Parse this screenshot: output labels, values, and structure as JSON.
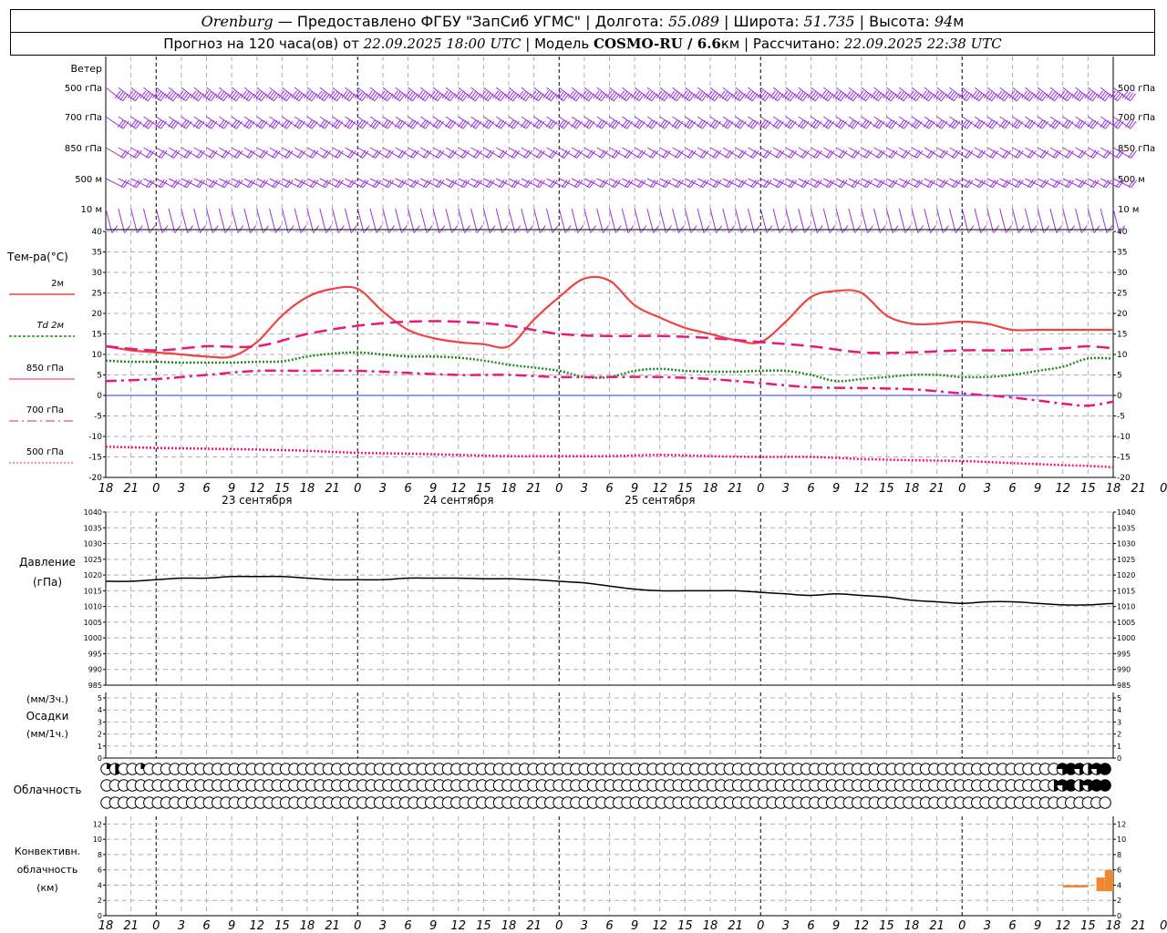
{
  "header": {
    "station": "Orenburg",
    "dash": " — ",
    "provider": "Предоставлено ФГБУ \"ЗапСиб УГМС\"",
    "sep": " | ",
    "lon_label": "Долгота: ",
    "lon_value": "55.089",
    "lat_label": "Широта: ",
    "lat_value": "51.735",
    "alt_label": "Высота: ",
    "alt_value": "94",
    "alt_unit": "м"
  },
  "subheader": {
    "forecast_label": "Прогноз на 120 часа(ов) от ",
    "forecast_time": "22.09.2025 18:00 UTC",
    "model_label": " | Модель ",
    "model_name": "COSMO-RU / 6.6",
    "model_unit": "км",
    "calc_label": " | Рассчитано: ",
    "calc_time": "22.09.2025 22:38 UTC"
  },
  "colors": {
    "wind": "#9b30d9",
    "t2m": "#ee4444",
    "td": "#1f8a1f",
    "p850": "#e8197a",
    "p700": "#e8197a",
    "p500": "#e8197a",
    "zero": "#3030ff",
    "pressure": "#000000",
    "convective": "#ee8833",
    "grid": "#b0b0b0"
  },
  "panels": {
    "wind": {
      "title": "Ветер",
      "levels": [
        "500 гПа",
        "700 гПа",
        "850 гПа",
        "500 м",
        "10  м"
      ]
    },
    "temp": {
      "title": "Тем-ра(°C)",
      "legend": [
        {
          "label": "2м",
          "key": "t2m"
        },
        {
          "label": "Td  2м",
          "key": "td"
        },
        {
          "label": "850 гПа",
          "key": "p850"
        },
        {
          "label": "700 гПа",
          "key": "p700"
        },
        {
          "label": "500 гПа",
          "key": "p500"
        }
      ],
      "ticks": [
        40,
        35,
        30,
        25,
        20,
        15,
        10,
        5,
        0,
        -5,
        -10,
        -15,
        -20
      ]
    },
    "pressure": {
      "title": "Давление",
      "unit": "(гПа)",
      "ticks": [
        1040,
        1035,
        1030,
        1025,
        1020,
        1015,
        1010,
        1005,
        1000,
        995,
        990,
        985
      ]
    },
    "precip": {
      "line1": "(мм/3ч.)",
      "line2": "Осадки",
      "line3": "(мм/1ч.)",
      "ticks": [
        5,
        4,
        3,
        2,
        1,
        0
      ]
    },
    "clouds": {
      "title": "Облачность"
    },
    "convective": {
      "line1": "Конвективн.",
      "line2": "облачность",
      "line3": "(км)",
      "ticks": [
        12,
        10,
        8,
        6,
        4,
        2,
        0
      ]
    }
  },
  "time_labels": [
    "18",
    "21",
    "0",
    "3",
    "6",
    "9",
    "12",
    "15",
    "18",
    "21",
    "0",
    "3",
    "6",
    "9",
    "12",
    "15",
    "18",
    "21",
    "0",
    "3",
    "6",
    "9",
    "12",
    "15",
    "18",
    "21",
    "0",
    "3",
    "6",
    "9",
    "12",
    "15",
    "18",
    "21",
    "0",
    "3",
    "6",
    "9",
    "12",
    "15",
    "18",
    "21",
    "0"
  ],
  "day_labels": [
    "23 сентября",
    "24 сентября",
    "25 сентября"
  ],
  "chart_data": [
    {
      "type": "line",
      "title": "Тем-ра(°C)",
      "x_unit": "hours from 22.09.2025 18:00 UTC",
      "ylim": [
        -20,
        40
      ],
      "series": [
        {
          "name": "2м",
          "x": [
            0,
            3,
            6,
            9,
            12,
            15,
            18,
            21,
            24,
            27,
            30,
            33,
            36,
            39,
            42,
            45,
            48,
            51,
            54,
            57,
            60,
            63,
            66,
            69,
            72,
            75,
            78,
            81,
            84,
            87,
            90,
            93,
            96,
            99,
            102,
            105,
            108,
            111,
            114,
            117,
            120
          ],
          "values": [
            12,
            11,
            10.5,
            10,
            9.5,
            9.5,
            13,
            19.5,
            24,
            26,
            26,
            20.5,
            16,
            14,
            13,
            12.5,
            12,
            18.5,
            24,
            28.5,
            28,
            22,
            19,
            16.5,
            15,
            13.5,
            13,
            18,
            24,
            25.5,
            25,
            19.5,
            17.5,
            17.5,
            18,
            17.5,
            16,
            16,
            16,
            16,
            16
          ]
        },
        {
          "name": "Td  2м",
          "x": [
            0,
            3,
            6,
            9,
            12,
            15,
            18,
            21,
            24,
            27,
            30,
            33,
            36,
            39,
            42,
            45,
            48,
            51,
            54,
            57,
            60,
            63,
            66,
            69,
            72,
            75,
            78,
            81,
            84,
            87,
            90,
            93,
            96,
            99,
            102,
            105,
            108,
            111,
            114,
            117,
            120
          ],
          "values": [
            8.5,
            8.2,
            8.2,
            8,
            8,
            8,
            8.2,
            8.3,
            9.5,
            10.2,
            10.5,
            10,
            9.5,
            9.5,
            9.2,
            8.5,
            7.5,
            6.8,
            6,
            4.5,
            4.5,
            6,
            6.5,
            6,
            5.8,
            5.8,
            6,
            6,
            5,
            3.5,
            4,
            4.5,
            5,
            5,
            4.5,
            4.5,
            5,
            6,
            7,
            9,
            9
          ]
        },
        {
          "name": "850 гПа",
          "x": [
            0,
            6,
            12,
            18,
            24,
            30,
            36,
            42,
            48,
            54,
            60,
            66,
            72,
            78,
            84,
            90,
            96,
            102,
            108,
            114,
            117,
            120
          ],
          "values": [
            12,
            11,
            12,
            12,
            15,
            17,
            18,
            18,
            17,
            15,
            14.5,
            14.5,
            14,
            13,
            12,
            10.5,
            10.5,
            11,
            11,
            11.5,
            12,
            11.5
          ]
        },
        {
          "name": "700 гПа",
          "x": [
            0,
            6,
            12,
            18,
            24,
            30,
            36,
            42,
            48,
            54,
            60,
            66,
            72,
            78,
            84,
            90,
            96,
            102,
            108,
            114,
            117,
            120
          ],
          "values": [
            3.5,
            4,
            5,
            6,
            6,
            6,
            5.5,
            5,
            5,
            4.5,
            4.5,
            4.5,
            4,
            3,
            2,
            1.8,
            1.5,
            0.5,
            -0.5,
            -2,
            -2.5,
            -1.5
          ]
        },
        {
          "name": "500 гПа",
          "x": [
            0,
            6,
            12,
            18,
            24,
            30,
            36,
            42,
            48,
            54,
            60,
            66,
            72,
            78,
            84,
            90,
            96,
            102,
            108,
            114,
            117,
            120
          ],
          "values": [
            -12.5,
            -12.8,
            -13,
            -13.2,
            -13.5,
            -14,
            -14.2,
            -14.5,
            -14.8,
            -14.8,
            -14.8,
            -14.5,
            -14.8,
            -15,
            -15,
            -15.5,
            -15.8,
            -16,
            -16.5,
            -17,
            -17.2,
            -17.5
          ]
        }
      ]
    },
    {
      "type": "line",
      "title": "Давление",
      "x_unit": "hours from 22.09.2025 18:00 UTC",
      "ylim": [
        985,
        1040
      ],
      "series": [
        {
          "name": "Давление",
          "x": [
            0,
            3,
            6,
            9,
            12,
            15,
            18,
            21,
            24,
            27,
            30,
            33,
            36,
            39,
            42,
            45,
            48,
            51,
            54,
            57,
            60,
            63,
            66,
            69,
            72,
            75,
            78,
            81,
            84,
            87,
            90,
            93,
            96,
            99,
            102,
            105,
            108,
            111,
            114,
            117,
            120
          ],
          "values": [
            1018,
            1018,
            1018.5,
            1019,
            1019,
            1019.5,
            1019.5,
            1019.5,
            1019,
            1018.5,
            1018.5,
            1018.5,
            1019,
            1019,
            1019,
            1018.8,
            1018.8,
            1018.5,
            1018,
            1017.5,
            1016.5,
            1015.5,
            1015,
            1015,
            1015,
            1015,
            1014.5,
            1014,
            1013.5,
            1014,
            1013.5,
            1013,
            1012,
            1011.5,
            1011,
            1011.5,
            1011.5,
            1011,
            1010.5,
            1010.5,
            1011
          ]
        }
      ]
    },
    {
      "type": "bar",
      "title": "Конвективн. облачность (км)",
      "x_unit": "hours from 22.09.2025 18:00 UTC",
      "ylim": [
        0,
        13
      ],
      "bars": [
        {
          "x_start": 114,
          "x_end": 117,
          "bottom": 3.7,
          "top": 4.0
        },
        {
          "x_start": 118,
          "x_end": 119,
          "bottom": 3.2,
          "top": 5.0
        },
        {
          "x_start": 119,
          "x_end": 120,
          "bottom": 3.2,
          "top": 6.0
        }
      ]
    },
    {
      "type": "table",
      "title": "Облачность",
      "rows": [
        {
          "cover": [
            1,
            2,
            0,
            0,
            1,
            0,
            0,
            0,
            0,
            0,
            0,
            0,
            0,
            0,
            0,
            0,
            0,
            0,
            0,
            0,
            0,
            0,
            0,
            0,
            0,
            0,
            0,
            0,
            0,
            0,
            0,
            0,
            0,
            0,
            0,
            0,
            0,
            0,
            0,
            0,
            0,
            0,
            0,
            0,
            0,
            0,
            0,
            0,
            0,
            0,
            0,
            0,
            0,
            0,
            0,
            0,
            0,
            0,
            0,
            0,
            0,
            0,
            0,
            0,
            0,
            0,
            0,
            0,
            0,
            0,
            0,
            0,
            0,
            0,
            0,
            0,
            0,
            0,
            0,
            0,
            0,
            0,
            0,
            0,
            0,
            0,
            0,
            0,
            0,
            0,
            0,
            0,
            0,
            0,
            0,
            0,
            0,
            0,
            0,
            0,
            0,
            0,
            0,
            0,
            0,
            0,
            0,
            0,
            0,
            0,
            0,
            0,
            3,
            4,
            3,
            2,
            3,
            4
          ]
        },
        {
          "cover": [
            0,
            0,
            0,
            0,
            0,
            0,
            0,
            0,
            0,
            0,
            0,
            0,
            0,
            0,
            0,
            0,
            0,
            0,
            0,
            0,
            0,
            0,
            0,
            0,
            0,
            0,
            0,
            0,
            0,
            0,
            0,
            0,
            0,
            0,
            0,
            0,
            0,
            0,
            0,
            0,
            0,
            0,
            0,
            0,
            0,
            0,
            0,
            0,
            0,
            0,
            0,
            0,
            0,
            0,
            0,
            0,
            0,
            0,
            0,
            0,
            0,
            0,
            0,
            0,
            0,
            0,
            0,
            0,
            0,
            0,
            0,
            0,
            0,
            0,
            0,
            0,
            0,
            0,
            0,
            0,
            0,
            0,
            0,
            0,
            0,
            0,
            0,
            0,
            0,
            0,
            0,
            0,
            0,
            0,
            0,
            0,
            0,
            0,
            0,
            0,
            0,
            0,
            0,
            0,
            0,
            0,
            0,
            0,
            0,
            0,
            0,
            2,
            3,
            4,
            2,
            3,
            4,
            4
          ]
        },
        {
          "cover": [
            0,
            0,
            0,
            0,
            0,
            0,
            0,
            0,
            0,
            0,
            0,
            0,
            0,
            0,
            0,
            0,
            0,
            0,
            0,
            0,
            0,
            0,
            0,
            0,
            0,
            0,
            0,
            0,
            0,
            0,
            0,
            0,
            0,
            0,
            0,
            0,
            0,
            0,
            0,
            0,
            0,
            0,
            0,
            0,
            0,
            0,
            0,
            0,
            0,
            0,
            0,
            0,
            0,
            0,
            0,
            0,
            0,
            0,
            0,
            0,
            0,
            0,
            0,
            0,
            0,
            0,
            0,
            0,
            0,
            0,
            0,
            0,
            0,
            0,
            0,
            0,
            0,
            0,
            0,
            0,
            0,
            0,
            0,
            0,
            0,
            0,
            0,
            0,
            0,
            0,
            0,
            0,
            0,
            0,
            0,
            0,
            0,
            0,
            0,
            0,
            0,
            0,
            0,
            0,
            0,
            0,
            0,
            0,
            0,
            0,
            0,
            0,
            0,
            0,
            0,
            0,
            0,
            0
          ]
        }
      ]
    },
    {
      "type": "table",
      "title": "Ветер",
      "rows": [
        {
          "level": "500 гПа",
          "dir_from": 250,
          "speed_kt": 35
        },
        {
          "level": "700 гПа",
          "dir_from": 255,
          "speed_kt": 25
        },
        {
          "level": "850 гПа",
          "dir_from": 260,
          "speed_kt": 20
        },
        {
          "level": "500 м",
          "dir_from": 265,
          "speed_kt": 15
        },
        {
          "level": "10  м",
          "dir_from": 200,
          "speed_kt": 8
        }
      ]
    }
  ]
}
